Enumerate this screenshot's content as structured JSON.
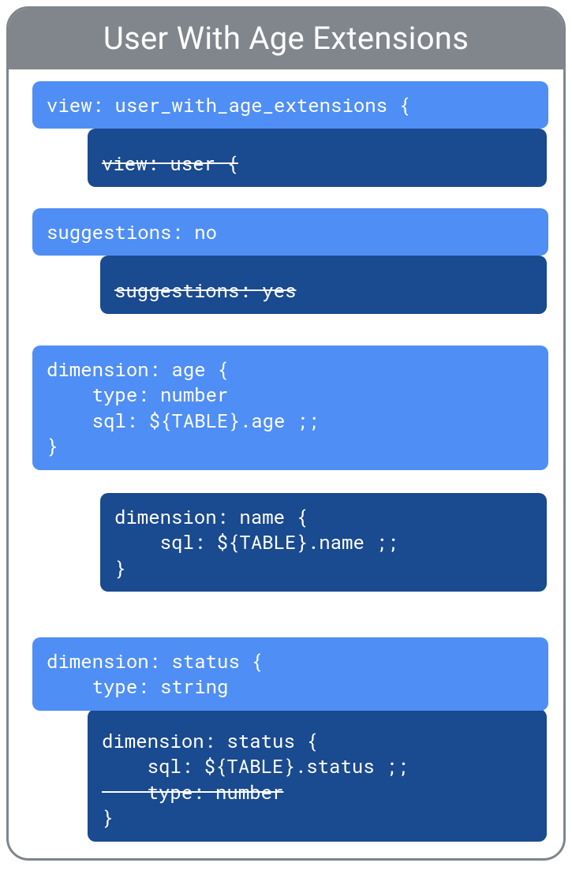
{
  "title": "User With Age Extensions",
  "blocks": {
    "view_ext": "view: user_with_age_extensions {",
    "view_user": "view: user {",
    "sugg_no": "suggestions: no",
    "sugg_yes": "suggestions: yes",
    "dim_age": "dimension: age {\n    type: number\n    sql: ${TABLE}.age ;;\n}",
    "dim_name": "dimension: name {\n    sql: ${TABLE}.name ;;\n}",
    "dim_status_new": "dimension: status {\n    type: string",
    "dim_status_old_l1": "dimension: status {",
    "dim_status_old_l2": "    sql: ${TABLE}.status ;;",
    "dim_status_old_l3": "    type: number",
    "dim_status_old_l4": "}"
  }
}
